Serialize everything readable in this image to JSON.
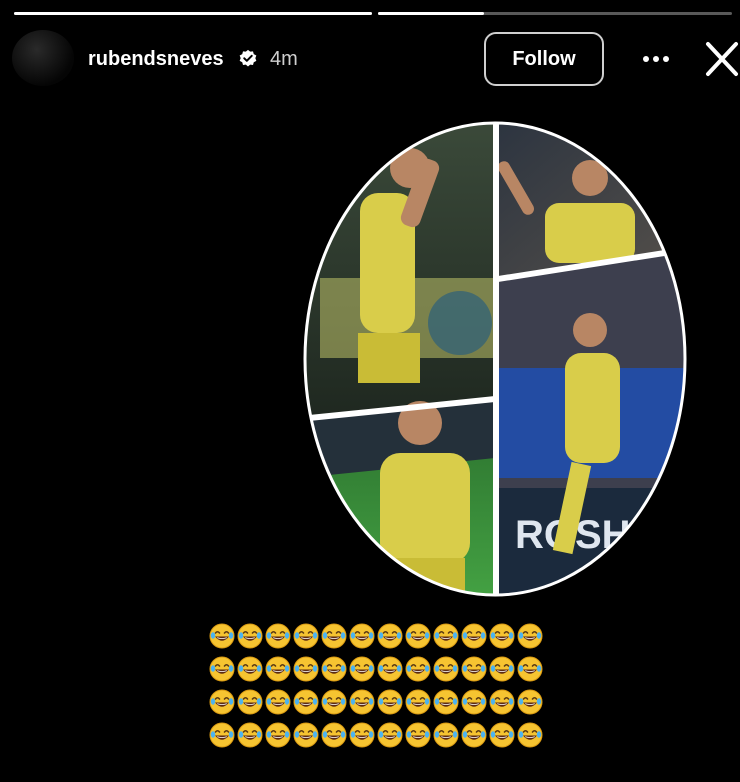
{
  "story": {
    "progress": [
      1.0,
      0.3
    ]
  },
  "header": {
    "username": "rubendsneves",
    "time_ago": "4m",
    "follow_label": "Follow",
    "verified_icon": "verified-badge-icon",
    "more_icon": "more-options-icon",
    "close_icon": "close-icon"
  },
  "media": {
    "type": "oval photo collage",
    "icon": "photo-collage"
  },
  "caption": {
    "emoji": "😂",
    "emoji_name": "face-with-tears-of-joy-icon",
    "rows": 4,
    "per_row": 12
  },
  "colors": {
    "background": "#000000",
    "jersey": "#d9cd4a",
    "field": "#3a8f3a",
    "follow_border": "#cfcfcf"
  }
}
